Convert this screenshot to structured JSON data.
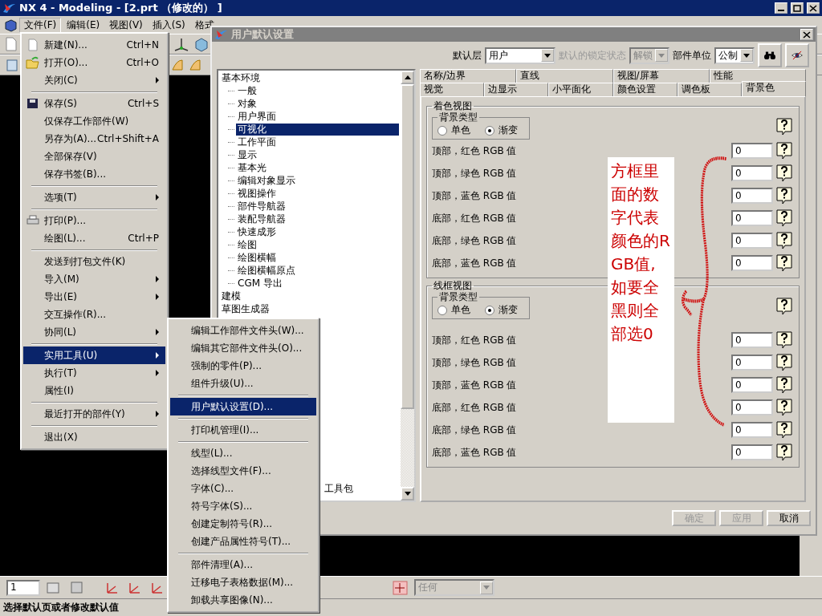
{
  "app": {
    "title": "NX 4 - Modeling - [2.prt （修改的） ]",
    "menubar": [
      {
        "label": "文件(F)",
        "selected": true
      },
      {
        "label": "编辑(E)",
        "selected": false
      },
      {
        "label": "视图(V)",
        "selected": false
      },
      {
        "label": "插入(S)",
        "selected": false
      },
      {
        "label": "格式",
        "selected": false
      }
    ],
    "layer_field": "1",
    "filter_dropdown": {
      "value": "任何",
      "disabled": true
    },
    "status_bar": "选择默认页或者修改默认值"
  },
  "file_menu": [
    {
      "kind": "item",
      "label": "新建(N)...",
      "shortcut": "Ctrl+N",
      "submenu": false,
      "selected": false
    },
    {
      "kind": "item",
      "label": "打开(O)...",
      "shortcut": "Ctrl+O",
      "submenu": false,
      "selected": false
    },
    {
      "kind": "item",
      "label": "关闭(C)",
      "submenu": true,
      "selected": false
    },
    {
      "kind": "separator"
    },
    {
      "kind": "item",
      "label": "保存(S)",
      "shortcut": "Ctrl+S",
      "submenu": false,
      "selected": false
    },
    {
      "kind": "item",
      "label": "仅保存工作部件(W)",
      "submenu": false,
      "selected": false
    },
    {
      "kind": "item",
      "label": "另存为(A)...",
      "shortcut": "Ctrl+Shift+A",
      "submenu": false,
      "selected": false
    },
    {
      "kind": "item",
      "label": "全部保存(V)",
      "submenu": false,
      "selected": false
    },
    {
      "kind": "item",
      "label": "保存书签(B)...",
      "submenu": false,
      "selected": false
    },
    {
      "kind": "separator"
    },
    {
      "kind": "item",
      "label": "选项(T)",
      "submenu": true,
      "selected": false
    },
    {
      "kind": "separator"
    },
    {
      "kind": "item",
      "label": "打印(P)...",
      "submenu": false,
      "selected": false
    },
    {
      "kind": "item",
      "label": "绘图(L)...",
      "shortcut": "Ctrl+P",
      "submenu": false,
      "selected": false
    },
    {
      "kind": "separator"
    },
    {
      "kind": "item",
      "label": "发送到打包文件(K)",
      "submenu": false,
      "selected": false
    },
    {
      "kind": "item",
      "label": "导入(M)",
      "submenu": true,
      "selected": false
    },
    {
      "kind": "item",
      "label": "导出(E)",
      "submenu": true,
      "selected": false
    },
    {
      "kind": "item",
      "label": "交互操作(R)...",
      "submenu": false,
      "selected": false
    },
    {
      "kind": "item",
      "label": "协同(L)",
      "submenu": true,
      "selected": false
    },
    {
      "kind": "separator"
    },
    {
      "kind": "item",
      "label": "实用工具(U)",
      "submenu": true,
      "selected": true
    },
    {
      "kind": "item",
      "label": "执行(T)",
      "submenu": true,
      "selected": false
    },
    {
      "kind": "item",
      "label": "属性(I)",
      "submenu": false,
      "selected": false
    },
    {
      "kind": "separator"
    },
    {
      "kind": "item",
      "label": "最近打开的部件(Y)",
      "submenu": true,
      "selected": false
    },
    {
      "kind": "separator"
    },
    {
      "kind": "item",
      "label": "退出(X)",
      "submenu": false,
      "selected": false
    }
  ],
  "utilities_menu": [
    {
      "kind": "item",
      "label": "编辑工作部件文件头(W)...",
      "selected": false
    },
    {
      "kind": "item",
      "label": "编辑其它部件文件头(O)...",
      "selected": false
    },
    {
      "kind": "item",
      "label": "强制的零件(P)...",
      "selected": false
    },
    {
      "kind": "item",
      "label": "组件升级(U)...",
      "selected": false
    },
    {
      "kind": "separator"
    },
    {
      "kind": "item",
      "label": "用户默认设置(D)...",
      "selected": true
    },
    {
      "kind": "separator"
    },
    {
      "kind": "item",
      "label": "打印机管理(I)...",
      "selected": false
    },
    {
      "kind": "separator"
    },
    {
      "kind": "item",
      "label": "线型(L)...",
      "selected": false
    },
    {
      "kind": "item",
      "label": "选择线型文件(F)...",
      "selected": false
    },
    {
      "kind": "item",
      "label": "字体(C)...",
      "selected": false
    },
    {
      "kind": "item",
      "label": "符号字体(S)...",
      "selected": false
    },
    {
      "kind": "item",
      "label": "创建定制符号(R)...",
      "selected": false
    },
    {
      "kind": "item",
      "label": "创建产品属性符号(T)...",
      "selected": false
    },
    {
      "kind": "separator"
    },
    {
      "kind": "item",
      "label": "部件清理(A)...",
      "selected": false
    },
    {
      "kind": "item",
      "label": "迁移电子表格数据(M)...",
      "selected": false
    },
    {
      "kind": "item",
      "label": "卸载共享图像(N)...",
      "selected": false
    }
  ],
  "dialog": {
    "title": "用户默认设置",
    "default_level": {
      "label": "默认层",
      "value": "用户"
    },
    "lock_state": {
      "label": "默认的锁定状态",
      "value": "解锁",
      "disabled": true
    },
    "part_units": {
      "label": "部件单位",
      "value": "公制"
    },
    "tree": [
      {
        "label": "基本环境",
        "selected": false,
        "children": [
          {
            "label": "一般",
            "selected": false
          },
          {
            "label": "对象",
            "selected": false
          },
          {
            "label": "用户界面",
            "selected": false
          },
          {
            "label": "可视化",
            "selected": true
          },
          {
            "label": "工作平面",
            "selected": false
          },
          {
            "label": "显示",
            "selected": false
          },
          {
            "label": "基本光",
            "selected": false
          },
          {
            "label": "编辑对象显示",
            "selected": false
          },
          {
            "label": "视图操作",
            "selected": false
          },
          {
            "label": "部件导航器",
            "selected": false
          },
          {
            "label": "装配导航器",
            "selected": false
          },
          {
            "label": "快速成形",
            "selected": false
          },
          {
            "label": "绘图",
            "selected": false
          },
          {
            "label": "绘图横幅",
            "selected": false
          },
          {
            "label": "绘图横幅原点",
            "selected": false
          },
          {
            "label": "CGM 导出",
            "selected": false
          }
        ]
      },
      {
        "label": "建模",
        "selected": false
      },
      {
        "label": "草图生成器",
        "selected": false
      },
      {
        "label": "工具包",
        "selected": false
      }
    ],
    "tab_rows": [
      [
        {
          "label": "名称/边界",
          "selected": false
        },
        {
          "label": "直线",
          "selected": false
        },
        {
          "label": "视图/屏幕",
          "selected": false
        },
        {
          "label": "性能",
          "selected": false
        }
      ],
      [
        {
          "label": "视觉",
          "selected": false
        },
        {
          "label": "边显示",
          "selected": false
        },
        {
          "label": "小平面化",
          "selected": false
        },
        {
          "label": "颜色设置",
          "selected": false
        },
        {
          "label": "调色板",
          "selected": false
        },
        {
          "label": "背景色",
          "selected": true
        }
      ]
    ],
    "groups": [
      {
        "title": "着色视图",
        "background_type": {
          "title": "背景类型",
          "options": [
            {
              "label": "单色",
              "selected": false
            },
            {
              "label": "渐变",
              "selected": true
            }
          ]
        },
        "fields": [
          {
            "label": "顶部，红色 RGB 值",
            "value": "0"
          },
          {
            "label": "顶部，绿色 RGB 值",
            "value": "0"
          },
          {
            "label": "顶部，蓝色 RGB 值",
            "value": "0"
          },
          {
            "label": "底部，红色 RGB 值",
            "value": "0"
          },
          {
            "label": "底部，绿色 RGB 值",
            "value": "0"
          },
          {
            "label": "底部，蓝色 RGB 值",
            "value": "0"
          }
        ]
      },
      {
        "title": "线框视图",
        "background_type": {
          "title": "背景类型",
          "options": [
            {
              "label": "单色",
              "selected": false
            },
            {
              "label": "渐变",
              "selected": true
            }
          ]
        },
        "fields": [
          {
            "label": "顶部，红色 RGB 值",
            "value": "0"
          },
          {
            "label": "顶部，绿色 RGB 值",
            "value": "0"
          },
          {
            "label": "顶部，蓝色 RGB 值",
            "value": "0"
          },
          {
            "label": "底部，红色 RGB 值",
            "value": "0"
          },
          {
            "label": "底部，绿色 RGB 值",
            "value": "0"
          },
          {
            "label": "底部，蓝色 RGB 值",
            "value": "0"
          }
        ]
      }
    ],
    "buttons": [
      {
        "label": "确定",
        "disabled": true
      },
      {
        "label": "应用",
        "disabled": true
      },
      {
        "label": "取消",
        "disabled": false
      }
    ],
    "annotation": "方框里面的数字代表颜色的RGB值,如要全黑则全部选0"
  }
}
